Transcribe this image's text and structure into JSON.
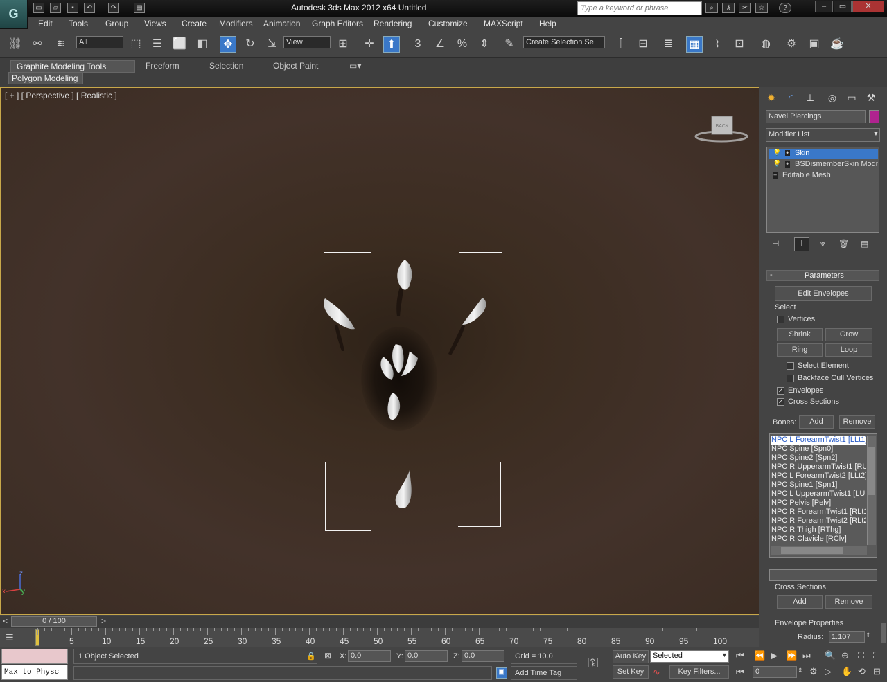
{
  "app": {
    "title": "Autodesk 3ds Max  2012 x64     Untitled",
    "logo_icon": "3ds-max-logo",
    "search_placeholder": "Type a keyword or phrase"
  },
  "menu": [
    "Edit",
    "Tools",
    "Group",
    "Views",
    "Create",
    "Modifiers",
    "Animation",
    "Graph Editors",
    "Rendering",
    "Customize",
    "MAXScript",
    "Help"
  ],
  "toolbar": {
    "selection_filter": "All",
    "reference_coord": "View",
    "named_selection_placeholder": "Create Selection Se",
    "snap_label": "3"
  },
  "ribbon": {
    "tabs": [
      "Graphite Modeling Tools",
      "Freeform",
      "Selection",
      "Object Paint"
    ],
    "panel": "Polygon Modeling"
  },
  "viewport": {
    "label": "[ + ] [ Perspective ] [ Realistic ]",
    "viewcube_face": "BACK",
    "axis_z": "z",
    "axis_x": "x",
    "axis_y": "y"
  },
  "command_panel": {
    "object_name": "Navel Piercings",
    "object_color": "#b0238f",
    "modifier_list": "Modifier List",
    "stack": [
      "Skin",
      "BSDismemberSkin Modifier",
      "Editable Mesh"
    ],
    "parameters_title": "Parameters",
    "edit_envelopes": "Edit Envelopes",
    "select_group": "Select",
    "vertices": "Vertices",
    "shrink": "Shrink",
    "grow": "Grow",
    "ring": "Ring",
    "loop": "Loop",
    "select_element": "Select Element",
    "backface_cull": "Backface Cull Vertices",
    "envelopes": "Envelopes",
    "cross_sections_chk": "Cross Sections",
    "bones_label": "Bones:",
    "add": "Add",
    "remove": "Remove",
    "bones": [
      "NPC L ForearmTwist1 [LLt1]",
      "NPC Spine [Spn0]",
      "NPC Spine2 [Spn2]",
      "NPC R UpperarmTwist1 [RUt1]",
      "NPC L ForearmTwist2 [LLt2]",
      "NPC Spine1 [Spn1]",
      "NPC L UpperarmTwist1 [LUt1]",
      "NPC Pelvis [Pelv]",
      "NPC R ForearmTwist1 [RLt1]",
      "NPC R ForearmTwist2 [RLt2]",
      "NPC R Thigh [RThg]",
      "NPC R Clavicle [RClv]"
    ],
    "cross_sections_title": "Cross Sections",
    "cs_add": "Add",
    "cs_remove": "Remove",
    "envelope_props": "Envelope Properties",
    "radius_label": "Radius:",
    "radius_value": "1.107"
  },
  "timeline": {
    "frame": "0 / 100",
    "ticks": [
      "0",
      "5",
      "10",
      "15",
      "20",
      "25",
      "30",
      "35",
      "40",
      "45",
      "50",
      "55",
      "60",
      "65",
      "70",
      "75",
      "80",
      "85",
      "90",
      "95",
      "100"
    ]
  },
  "status": {
    "script_listener": "Max to Physc",
    "selection": "1 Object Selected",
    "x_label": "X:",
    "x": "0.0",
    "y_label": "Y:",
    "y": "0.0",
    "z_label": "Z:",
    "z": "0.0",
    "grid": "Grid = 10.0",
    "add_time_tag": "Add Time Tag",
    "auto_key": "Auto Key",
    "set_key": "Set Key",
    "key_mode": "Selected",
    "key_filters": "Key Filters...",
    "current_frame": "0"
  }
}
